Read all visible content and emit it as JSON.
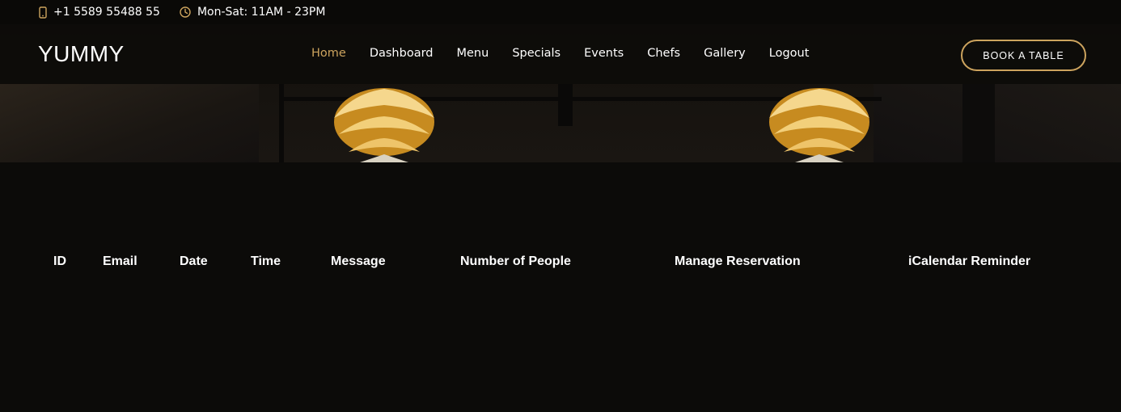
{
  "topbar": {
    "phone": "+1 5589 55488 55",
    "hours": "Mon-Sat: 11AM - 23PM",
    "phone_icon": "mobile-phone-icon",
    "clock_icon": "clock-icon"
  },
  "header": {
    "logo": "YUMMY",
    "nav": [
      "Home",
      "Dashboard",
      "Menu",
      "Specials",
      "Events",
      "Chefs",
      "Gallery",
      "Logout"
    ],
    "active_nav": "Home",
    "book_button": "BOOK A TABLE"
  },
  "table": {
    "headers": [
      "ID",
      "Email",
      "Date",
      "Time",
      "Message",
      "Number of People",
      "Manage Reservation",
      "iCalendar Reminder"
    ],
    "rows": []
  },
  "colors": {
    "accent": "#cda45e",
    "background": "#0c0b09",
    "text": "#ffffff"
  }
}
